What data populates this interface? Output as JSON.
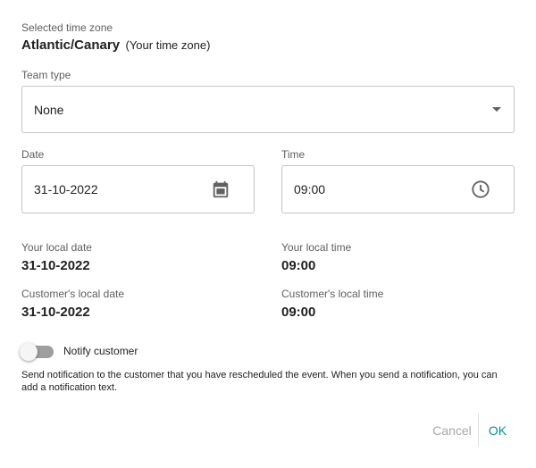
{
  "timezone": {
    "label": "Selected time zone",
    "name": "Atlantic/Canary",
    "note": "(Your time zone)"
  },
  "team_type": {
    "label": "Team type",
    "value": "None",
    "icon": "dropdown-arrow-icon"
  },
  "date": {
    "label": "Date",
    "value": "31-10-2022",
    "icon": "calendar-icon"
  },
  "time": {
    "label": "Time",
    "value": "09:00",
    "icon": "clock-icon"
  },
  "local": {
    "your_date_label": "Your local date",
    "your_date_value": "31-10-2022",
    "your_time_label": "Your local time",
    "your_time_value": "09:00",
    "customer_date_label": "Customer's local date",
    "customer_date_value": "31-10-2022",
    "customer_time_label": "Customer's local time",
    "customer_time_value": "09:00"
  },
  "notify": {
    "label": "Notify customer",
    "enabled": false,
    "help": "Send notification to the customer that you have rescheduled the event. When you send a notification, you can add a notification text."
  },
  "actions": {
    "cancel_label": "Cancel",
    "ok_label": "OK"
  },
  "colors": {
    "accent": "#009688",
    "text": "#212121",
    "muted": "#5f5f5f",
    "border": "#c4c4c4",
    "disabled": "#a8a8a8"
  }
}
